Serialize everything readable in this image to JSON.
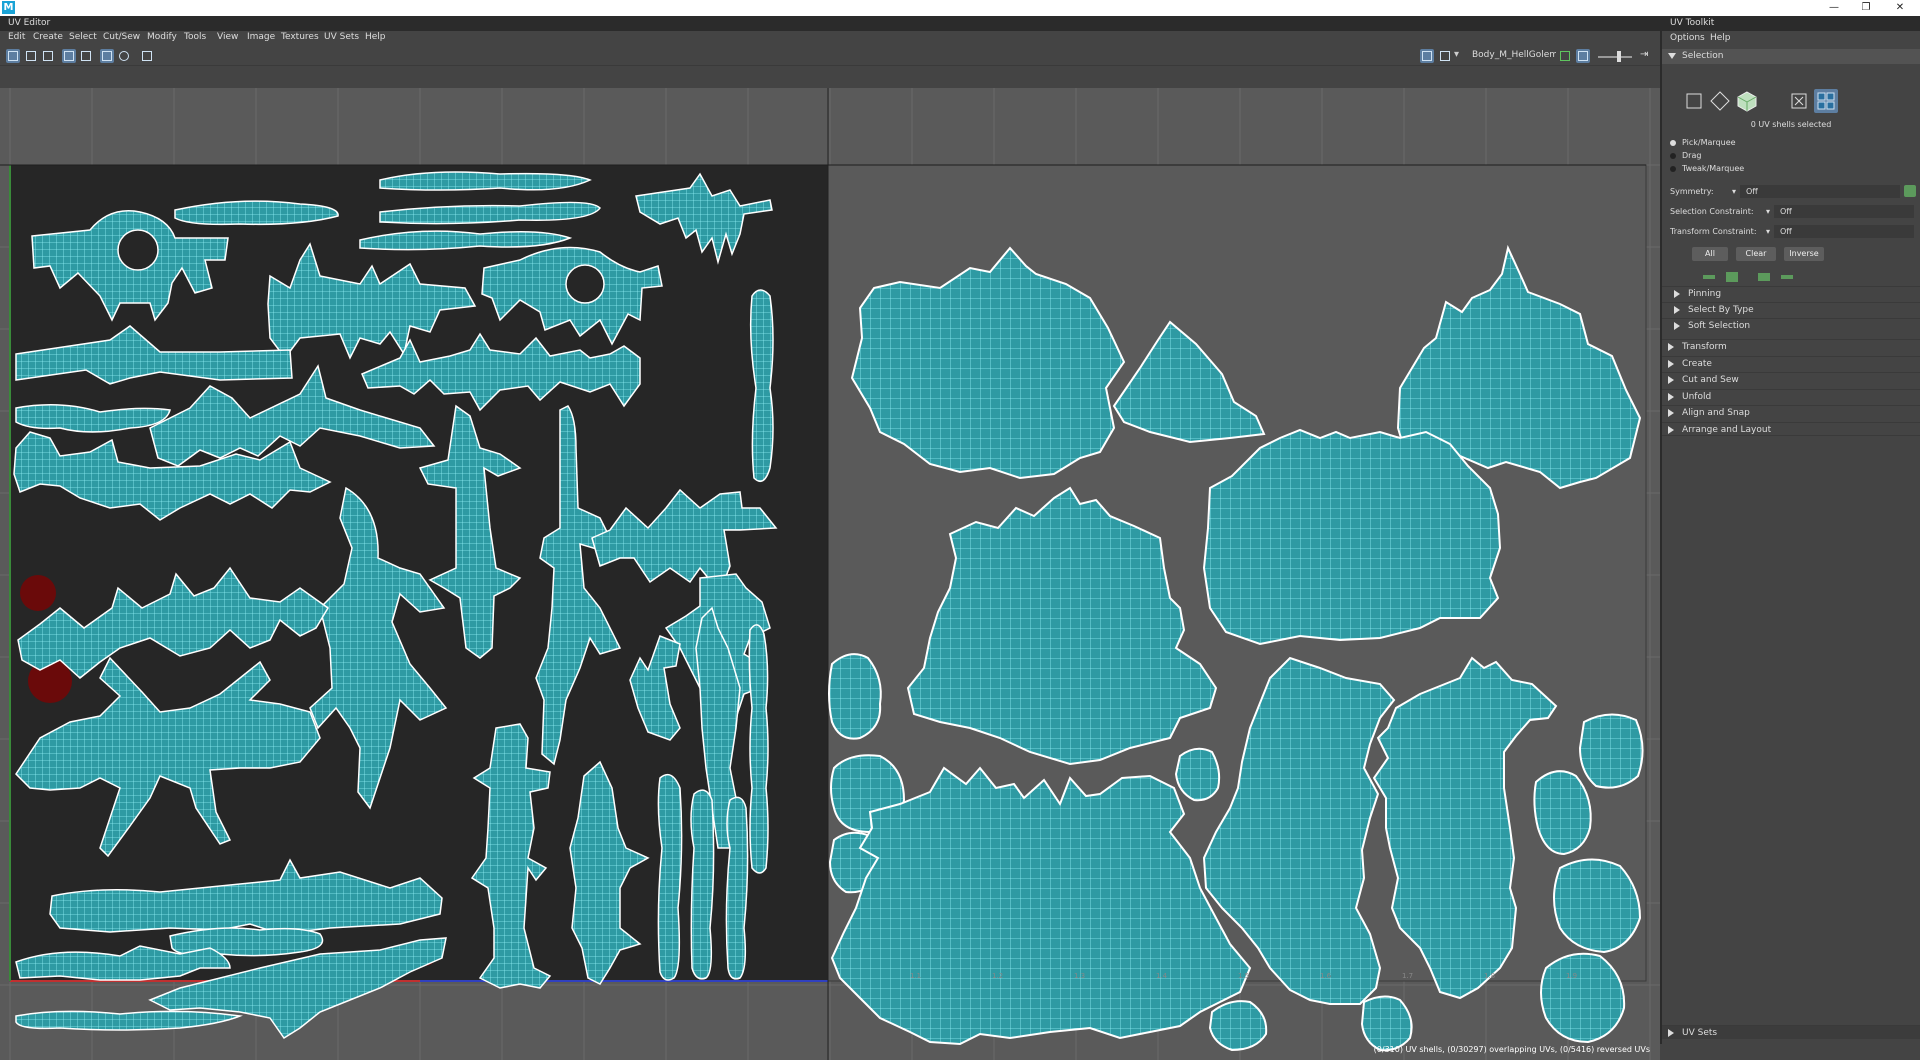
{
  "os": {
    "app_icon": "M",
    "minimize": "—",
    "restore": "❐",
    "close": "✕"
  },
  "uv_editor": {
    "title": "UV Editor",
    "menu": [
      "Edit",
      "Create",
      "Select",
      "Cut/Sew",
      "Modify",
      "Tools",
      "View",
      "Image",
      "Textures",
      "UV Sets",
      "Help"
    ],
    "mesh_name": "Body_M_HellGolemW",
    "status": "(0/310) UV shells, (0/30297) overlapping UVs, (0/5416) reversed UVs",
    "axis_ticks": [
      "1.1",
      "1.2",
      "1.3",
      "1.4",
      "1.5",
      "1.6",
      "1.7",
      "1.8",
      "1.9"
    ],
    "colors": {
      "uv_tile_bg": "#262626",
      "shell_fill": "#2e9aa3",
      "wireframe": "#7de8f0",
      "border": "#ffffff",
      "grid": "#777777"
    }
  },
  "toolkit": {
    "title": "UV Toolkit",
    "menu": [
      "Options",
      "Help"
    ],
    "selection": {
      "header": "Selection",
      "shells_selected": "0 UV shells selected",
      "modes": [
        "Pick/Marquee",
        "Drag",
        "Tweak/Marquee"
      ],
      "symmetry_label": "Symmetry:",
      "symmetry_value": "Off",
      "selection_constraint_label": "Selection Constraint:",
      "selection_constraint_value": "Off",
      "transform_constraint_label": "Transform Constraint:",
      "transform_constraint_value": "Off",
      "buttons": [
        "All",
        "Clear",
        "Inverse"
      ],
      "subsections": [
        "Pinning",
        "Select By Type",
        "Soft Selection"
      ]
    },
    "sections": [
      "Transform",
      "Create",
      "Cut and Sew",
      "Unfold",
      "Align and Snap",
      "Arrange and Layout"
    ],
    "uv_sets": "UV Sets"
  }
}
